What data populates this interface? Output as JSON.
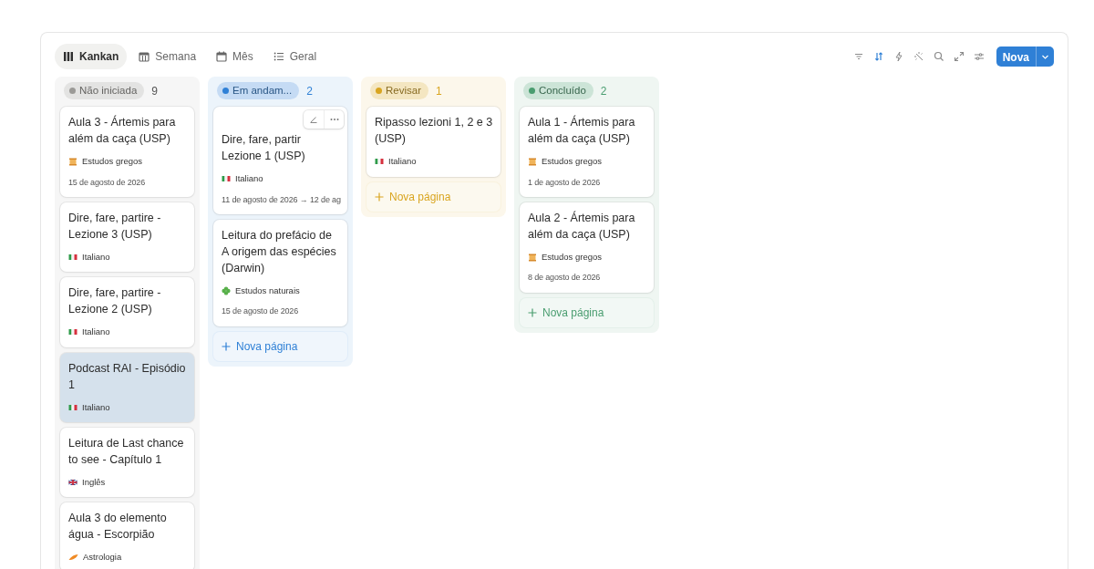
{
  "views": [
    {
      "label": "Kankan",
      "kind": "board",
      "selected": true
    },
    {
      "label": "Semana",
      "kind": "week",
      "selected": false
    },
    {
      "label": "Mês",
      "kind": "month",
      "selected": false
    },
    {
      "label": "Geral",
      "kind": "list",
      "selected": false
    }
  ],
  "toolbar": {
    "new_button": "Nova",
    "sort_active": true
  },
  "columns": [
    {
      "status": "Não iniciada",
      "color": "#9b9a97",
      "count": "9",
      "cards": [
        {
          "title": "Aula 3 - Ártemis para além da caça (USP)",
          "tag": {
            "label": "Estudos gregos",
            "kind": "scroll"
          },
          "date": "15 de agosto de 2026",
          "selected": false,
          "hovered": false
        },
        {
          "title": "Dire, fare, partire - Lezione 3 (USP)",
          "tag": {
            "label": "Italiano",
            "kind": "flag-it"
          },
          "selected": false,
          "hovered": false
        },
        {
          "title": "Dire, fare, partire - Lezione 2 (USP)",
          "tag": {
            "label": "Italiano",
            "kind": "flag-it"
          },
          "selected": false,
          "hovered": false
        },
        {
          "title": "Podcast RAI - Episódio 1",
          "tag": {
            "label": "Italiano",
            "kind": "flag-it"
          },
          "selected": true,
          "hovered": false
        },
        {
          "title": "Leitura de Last chance to see - Capítulo 1",
          "tag": {
            "label": "Inglês",
            "kind": "flag-uk"
          },
          "selected": false,
          "hovered": false
        },
        {
          "title": "Aula 3 do elemento água - Escorpião",
          "tag": {
            "label": "Astrologia",
            "kind": "feather"
          },
          "selected": false,
          "hovered": false
        }
      ]
    },
    {
      "status": "Em andam...",
      "color": "#2f80d6",
      "count": "2",
      "cards": [
        {
          "title": "Dire, fare, partir Lezione 1 (USP)",
          "tag": {
            "label": "Italiano",
            "kind": "flag-it"
          },
          "date": "11 de agosto de 2026 → 12 de ag",
          "selected": false,
          "hovered": true
        },
        {
          "title": "Leitura do prefácio de A origem das espécies (Darwin)",
          "tag": {
            "label": "Estudos naturais",
            "kind": "clover"
          },
          "date": "15 de agosto de 2026",
          "selected": false,
          "hovered": false
        }
      ],
      "add_label": "Nova página"
    },
    {
      "status": "Revisar",
      "color": "#d9a520",
      "count": "1",
      "cards": [
        {
          "title": "Ripasso lezioni 1, 2 e 3 (USP)",
          "tag": {
            "label": "Italiano",
            "kind": "flag-it"
          },
          "selected": false,
          "hovered": false
        }
      ],
      "add_label": "Nova página"
    },
    {
      "status": "Concluído",
      "color": "#4a9d70",
      "count": "2",
      "cards": [
        {
          "title": "Aula 1 - Ártemis para além da caça (USP)",
          "tag": {
            "label": "Estudos gregos",
            "kind": "scroll"
          },
          "date": "1 de agosto de 2026",
          "selected": false,
          "hovered": false
        },
        {
          "title": "Aula 2 - Ártemis para além da caça (USP)",
          "tag": {
            "label": "Estudos gregos",
            "kind": "scroll"
          },
          "date": "8 de agosto de 2026",
          "selected": false,
          "hovered": false
        }
      ],
      "add_label": "Nova página"
    }
  ]
}
